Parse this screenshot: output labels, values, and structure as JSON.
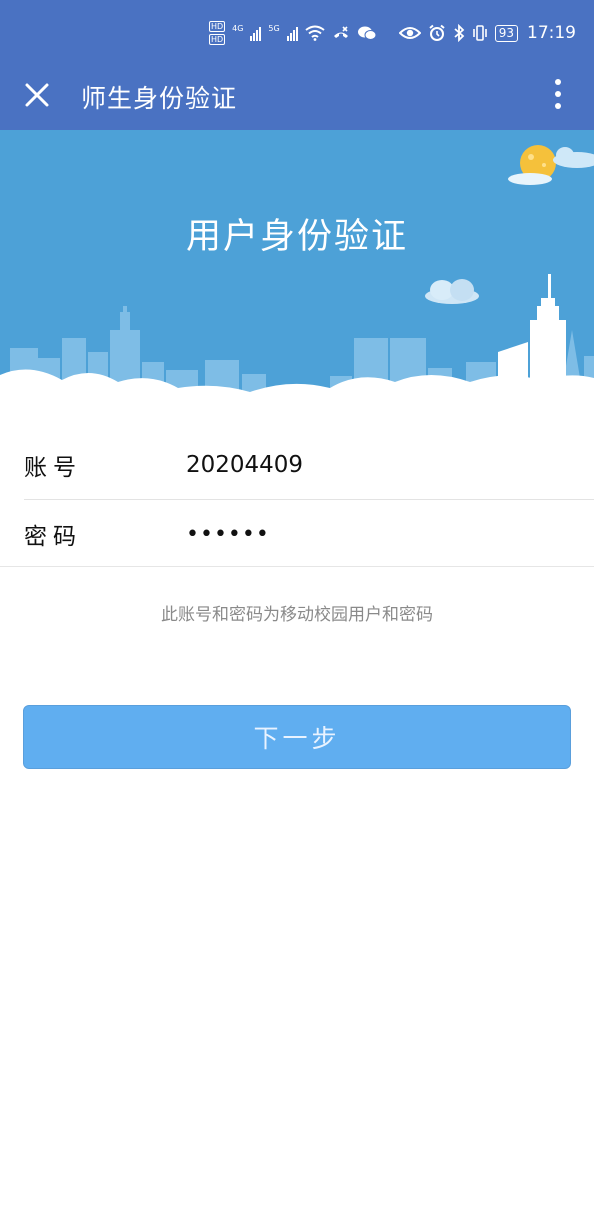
{
  "status_bar": {
    "hd_badges": [
      "HD",
      "HD"
    ],
    "network_1": "4G",
    "network_2": "5G",
    "battery": "93",
    "time": "17:19",
    "icons": [
      "signal-icon",
      "wifi-icon",
      "call-icon",
      "wechat-icon",
      "eye-icon",
      "alarm-icon",
      "bluetooth-icon",
      "vibrate-icon",
      "battery-icon"
    ]
  },
  "app_bar": {
    "title": "师生身份验证",
    "close_icon": "close-icon",
    "more_icon": "more-vertical-icon"
  },
  "banner": {
    "title": "用户身份验证"
  },
  "form": {
    "account_label": "账号",
    "account_value": "20204409",
    "password_label": "密码",
    "password_value": "••••••"
  },
  "hint": "此账号和密码为移动校园用户和密码",
  "next_button": "下一步",
  "colors": {
    "primary": "#4a72c2",
    "banner": "#4da1d7",
    "button": "#60aef0"
  }
}
